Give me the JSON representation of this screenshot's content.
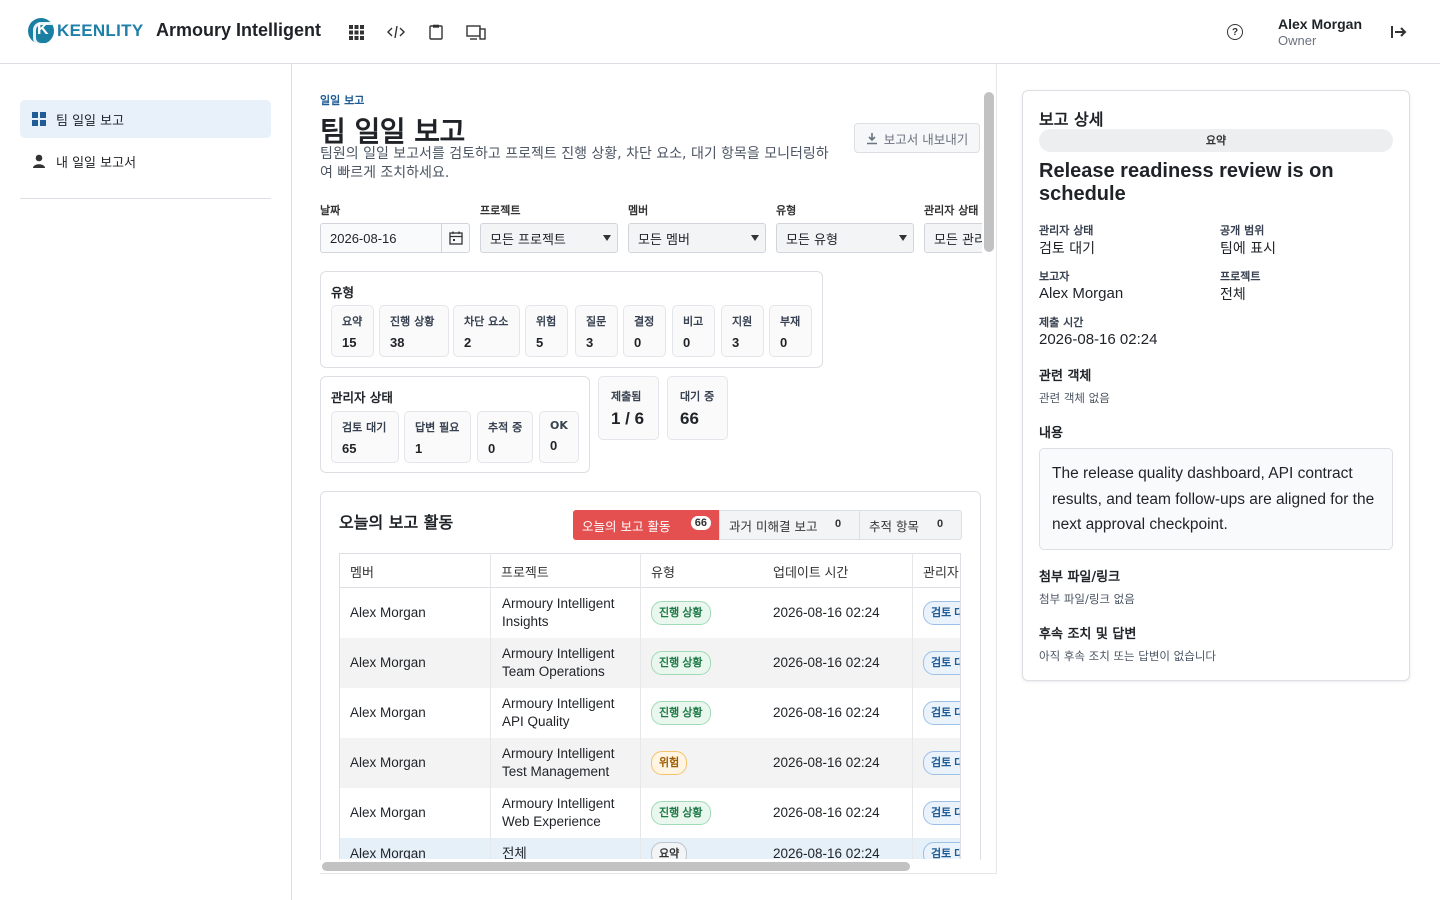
{
  "brand": {
    "logo_text": "KEENLITY",
    "logo_letter": "K"
  },
  "app_title": "Armoury Intelligent",
  "toolbar_icons": [
    "apps-grid-icon",
    "code-icon",
    "clipboard-icon",
    "devices-icon"
  ],
  "help_glyph": "?",
  "user": {
    "name": "Alex Morgan",
    "role": "Owner"
  },
  "sidebar": {
    "items": [
      {
        "label": "팀 일일 보고",
        "active": true
      },
      {
        "label": "내 일일 보고서",
        "active": false
      }
    ]
  },
  "page": {
    "breadcrumb": "일일 보고",
    "title": "팀 일일 보고",
    "description": "팀원의 일일 보고서를 검토하고 프로젝트 진행 상황, 차단 요소, 대기 항목을 모니터링하여 빠르게 조치하세요.",
    "export_label": "보고서 내보내기"
  },
  "filters": {
    "date": {
      "label": "날짜",
      "value": "2026-08-16"
    },
    "project": {
      "label": "프로젝트",
      "value": "모든 프로젝트"
    },
    "member": {
      "label": "멤버",
      "value": "모든 멤버"
    },
    "type": {
      "label": "유형",
      "value": "모든 유형"
    },
    "manager_status": {
      "label": "관리자 상태",
      "value": "모든 관리자 상태"
    }
  },
  "type_panel": {
    "title": "유형",
    "chips": [
      {
        "label": "요약",
        "value": "15"
      },
      {
        "label": "진행 상황",
        "value": "38"
      },
      {
        "label": "차단 요소",
        "value": "2"
      },
      {
        "label": "위험",
        "value": "5"
      },
      {
        "label": "질문",
        "value": "3"
      },
      {
        "label": "결정",
        "value": "0"
      },
      {
        "label": "비고",
        "value": "0"
      },
      {
        "label": "지원",
        "value": "3"
      },
      {
        "label": "부재",
        "value": "0"
      }
    ]
  },
  "manager_panel": {
    "title": "관리자 상태",
    "chips": [
      {
        "label": "검토 대기",
        "value": "65"
      },
      {
        "label": "답변 필요",
        "value": "1"
      },
      {
        "label": "추적 중",
        "value": "0"
      },
      {
        "label": "OK",
        "value": "0"
      }
    ]
  },
  "stats": [
    {
      "label": "제출됨",
      "value": "1 / 6"
    },
    {
      "label": "대기 중",
      "value": "66"
    }
  ],
  "activity": {
    "title": "오늘의 보고 활동",
    "segments": [
      {
        "label": "오늘의 보고 활동",
        "count": "66",
        "active": true
      },
      {
        "label": "과거 미해결 보고",
        "count": "0",
        "active": false
      },
      {
        "label": "추적 항목",
        "count": "0",
        "active": false
      }
    ],
    "columns": [
      "멤버",
      "프로젝트",
      "유형",
      "업데이트 시간",
      "관리자 상태"
    ],
    "rows": [
      {
        "member": "Alex Morgan",
        "project": "Armoury Intelligent Insights",
        "type": "진행 상황",
        "updated": "2026-08-16 02:24",
        "status": "검토 대기"
      },
      {
        "member": "Alex Morgan",
        "project": "Armoury Intelligent Team Operations",
        "type": "진행 상황",
        "updated": "2026-08-16 02:24",
        "status": "검토 대기"
      },
      {
        "member": "Alex Morgan",
        "project": "Armoury Intelligent API Quality",
        "type": "진행 상황",
        "updated": "2026-08-16 02:24",
        "status": "검토 대기"
      },
      {
        "member": "Alex Morgan",
        "project": "Armoury Intelligent Test Management",
        "type": "위험",
        "updated": "2026-08-16 02:24",
        "status": "검토 대기"
      },
      {
        "member": "Alex Morgan",
        "project": "Armoury Intelligent Web Experience",
        "type": "진행 상황",
        "updated": "2026-08-16 02:24",
        "status": "검토 대기"
      },
      {
        "member": "Alex Morgan",
        "project": "전체",
        "type": "요약",
        "updated": "2026-08-16 02:24",
        "status": "검토 대기"
      }
    ]
  },
  "detail": {
    "title": "보고 상세",
    "type_pill": "요약",
    "headline": "Release readiness review is on schedule",
    "fields": {
      "manager_status": {
        "label": "관리자 상태",
        "value": "검토 대기"
      },
      "visibility": {
        "label": "공개 범위",
        "value": "팀에 표시"
      },
      "reporter": {
        "label": "보고자",
        "value": "Alex Morgan"
      },
      "project": {
        "label": "프로젝트",
        "value": "전체"
      },
      "submitted": {
        "label": "제출 시간",
        "value": "2026-08-16 02:24"
      }
    },
    "related": {
      "title": "관련 객체",
      "empty": "관련 객체 없음"
    },
    "content": {
      "title": "내용",
      "body": "The release quality dashboard, API contract results, and team follow-ups are aligned for the next approval checkpoint."
    },
    "attachments": {
      "title": "첨부 파일/링크",
      "empty": "첨부 파일/링크 없음"
    },
    "followups": {
      "title": "후속 조치 및 답변",
      "empty": "아직 후속 조치 또는 답변이 없습니다"
    }
  }
}
